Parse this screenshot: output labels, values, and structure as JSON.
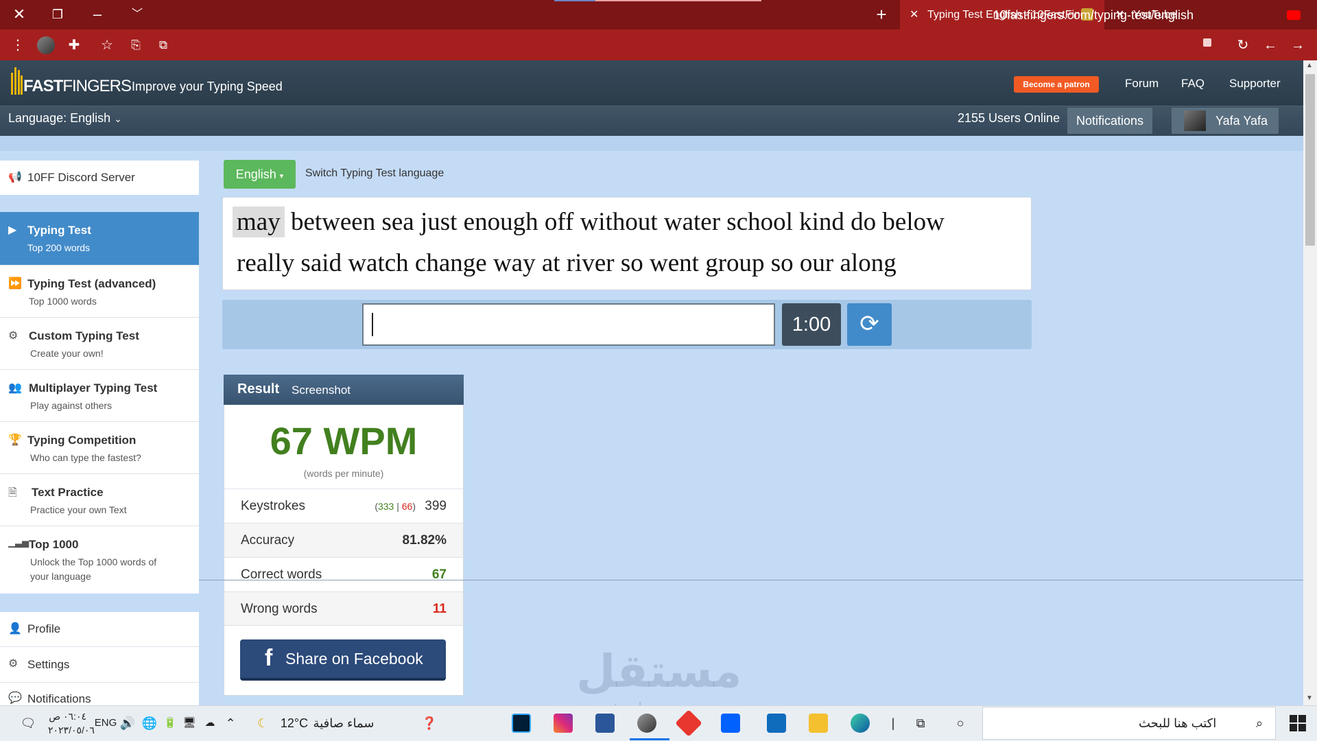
{
  "browser": {
    "tabs": [
      {
        "title": "Typing Test English - 10FastFinge",
        "active": true
      },
      {
        "title": "YouTube",
        "active": false
      }
    ],
    "url": "10fastfingers.com/typing-test/english"
  },
  "site": {
    "logo_bold": "FAST",
    "logo_thin": "FINGERS",
    "tagline": "Improve your Typing Speed",
    "patron_label": "Become a patron",
    "nav": [
      "Forum",
      "FAQ",
      "Supporter"
    ],
    "language_label": "Language: English",
    "users_online": "2155 Users Online",
    "notifications_label": "Notifications",
    "user_name": "Yafa Yafa"
  },
  "sidebar": {
    "discord": "10FF Discord Server",
    "items": [
      {
        "title": "Typing Test",
        "sub": "Top 200 words",
        "icon": "play-icon"
      },
      {
        "title": "Typing Test (advanced)",
        "sub": "Top 1000 words",
        "icon": "fast-forward-icon"
      },
      {
        "title": "Custom Typing Test",
        "sub": "Create your own!",
        "icon": "gears-icon"
      },
      {
        "title": "Multiplayer Typing Test",
        "sub": "Play against others",
        "icon": "users-icon"
      },
      {
        "title": "Typing Competition",
        "sub": "Who can type the fastest?",
        "icon": "trophy-icon"
      },
      {
        "title": "Text Practice",
        "sub": "Practice your own Text",
        "icon": "document-icon"
      },
      {
        "title": "Top 1000",
        "sub": "Unlock the Top 1000 words of your language",
        "icon": "signal-icon"
      }
    ],
    "bottom": [
      "Profile",
      "Settings",
      "Notifications"
    ]
  },
  "test": {
    "language_button": "English",
    "switch_label": "Switch Typing Test language",
    "current_word": "may",
    "line1_rest": "between sea just enough off without water school kind do below",
    "line2": "really said watch change way at river so went group so our along",
    "input_value": "",
    "timer": "1:00"
  },
  "result": {
    "title": "Result",
    "screenshot_label": "Screenshot",
    "wpm": "67 WPM",
    "wpm_sub": "(words per minute)",
    "keystrokes_label": "Keystrokes",
    "keystrokes_correct": "333",
    "keystrokes_wrong": "66",
    "keystrokes_total": "399",
    "accuracy_label": "Accuracy",
    "accuracy": "81.82%",
    "correct_label": "Correct words",
    "correct": "67",
    "wrong_label": "Wrong words",
    "wrong": "11",
    "share_label": "Share on Facebook"
  },
  "watermark": {
    "ar": "مستقل",
    "en": "mostaql.com"
  },
  "taskbar": {
    "search_placeholder": "اكتب هنا للبحث",
    "weather_text": "سماء صافية",
    "temperature": "12°C",
    "lang": "ENG",
    "time": "٠٦:٠٤ ص",
    "date": "٢٠٢٣/٠٥/٠٦"
  },
  "colors": {
    "browser_frame": "#7c1515",
    "accent_blue": "#428bca",
    "green": "#5cb85c",
    "wpm_green": "#42801f",
    "wrong_red": "#d9281c"
  }
}
